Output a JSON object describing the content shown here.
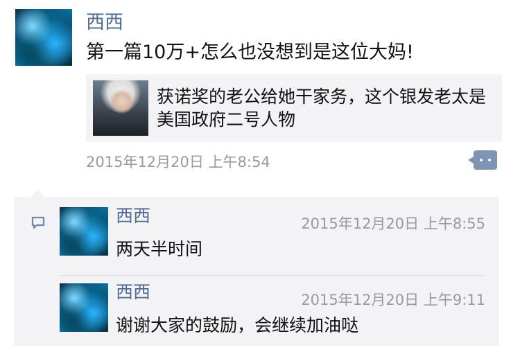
{
  "post": {
    "author": "西西",
    "text": "第一篇10万+怎么也没想到是这位大妈!",
    "shared_article": {
      "title": "获诺奖的老公给她干家务，这个银发老太是美国政府二号人物"
    },
    "timestamp": "2015年12月20日 上午8:54"
  },
  "comments": [
    {
      "author": "西西",
      "text": "两天半时间",
      "timestamp": "2015年12月20日 上午8:55"
    },
    {
      "author": "西西",
      "text": "谢谢大家的鼓励，会继续加油哒",
      "timestamp": "2015年12月20日 上午9:11"
    }
  ],
  "colors": {
    "name": "#4e6a92",
    "timestamp": "#9a9a9a",
    "panel": "#f3f3f5",
    "more_button": "#7f93b3"
  },
  "icons": {
    "more": "more-dots-icon",
    "comment": "comment-bubble-icon"
  }
}
